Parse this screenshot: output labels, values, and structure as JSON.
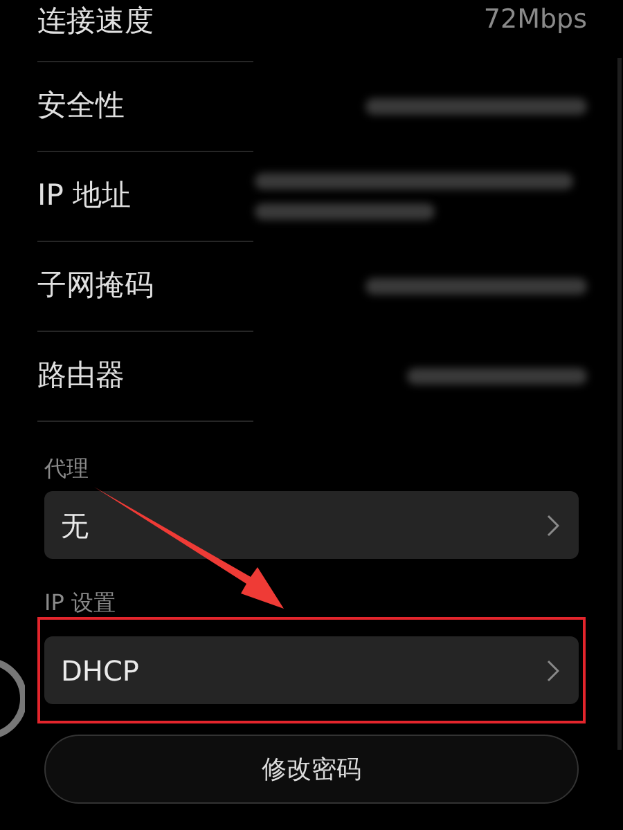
{
  "details": [
    {
      "label": "连接速度",
      "kind": "text",
      "value": "72Mbps"
    },
    {
      "label": "安全性",
      "kind": "redacted"
    },
    {
      "label": "IP 地址",
      "kind": "redacted_multiline"
    },
    {
      "label": "子网掩码",
      "kind": "redacted"
    },
    {
      "label": "路由器",
      "kind": "redacted"
    }
  ],
  "sections": [
    {
      "label": "代理",
      "value": "无",
      "highlighted": false
    },
    {
      "label": "IP 设置",
      "value": "DHCP",
      "highlighted": true
    }
  ],
  "button": "修改密码"
}
